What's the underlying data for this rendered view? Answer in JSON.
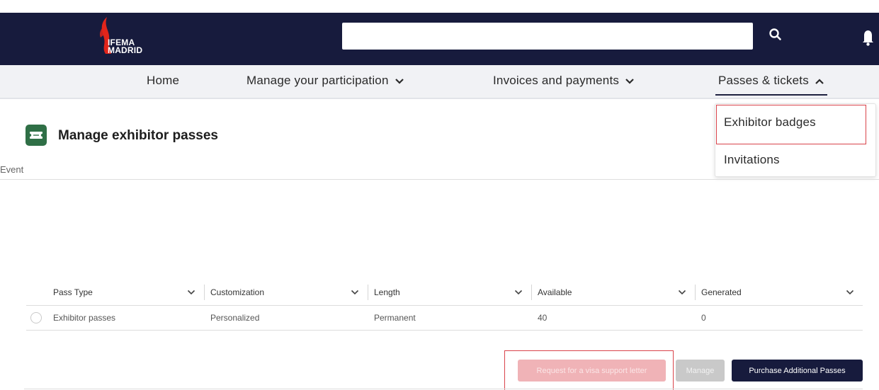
{
  "header": {
    "logo": {
      "line1": "IFEMA",
      "line2": "MADRID"
    },
    "search_placeholder": "",
    "search_icon": "search-icon",
    "bell_icon": "bell-icon"
  },
  "nav": {
    "items": [
      {
        "label": "Home"
      },
      {
        "label": "Manage your participation"
      },
      {
        "label": "Invoices and payments"
      },
      {
        "label": "Passes & tickets"
      }
    ],
    "dropdown": [
      {
        "label": "Exhibitor badges"
      },
      {
        "label": "Invitations"
      }
    ]
  },
  "page": {
    "title": "Manage exhibitor passes",
    "event_label": "Event"
  },
  "table": {
    "columns": [
      "Pass Type",
      "Customization",
      "Length",
      "Available",
      "Generated"
    ],
    "rows": [
      [
        "Exhibitor passes",
        "Personalized",
        "Permanent",
        "40",
        "0"
      ]
    ]
  },
  "actions": {
    "visa_label": "Request for a visa support letter",
    "manage_label": "Manage",
    "purchase_label": "Purchase Additional Passes"
  },
  "colors": {
    "header_bg": "#171b3d",
    "logo_red": "#e1251b",
    "page_icon_green": "#2f6f46",
    "highlight_red": "#d9434a"
  }
}
